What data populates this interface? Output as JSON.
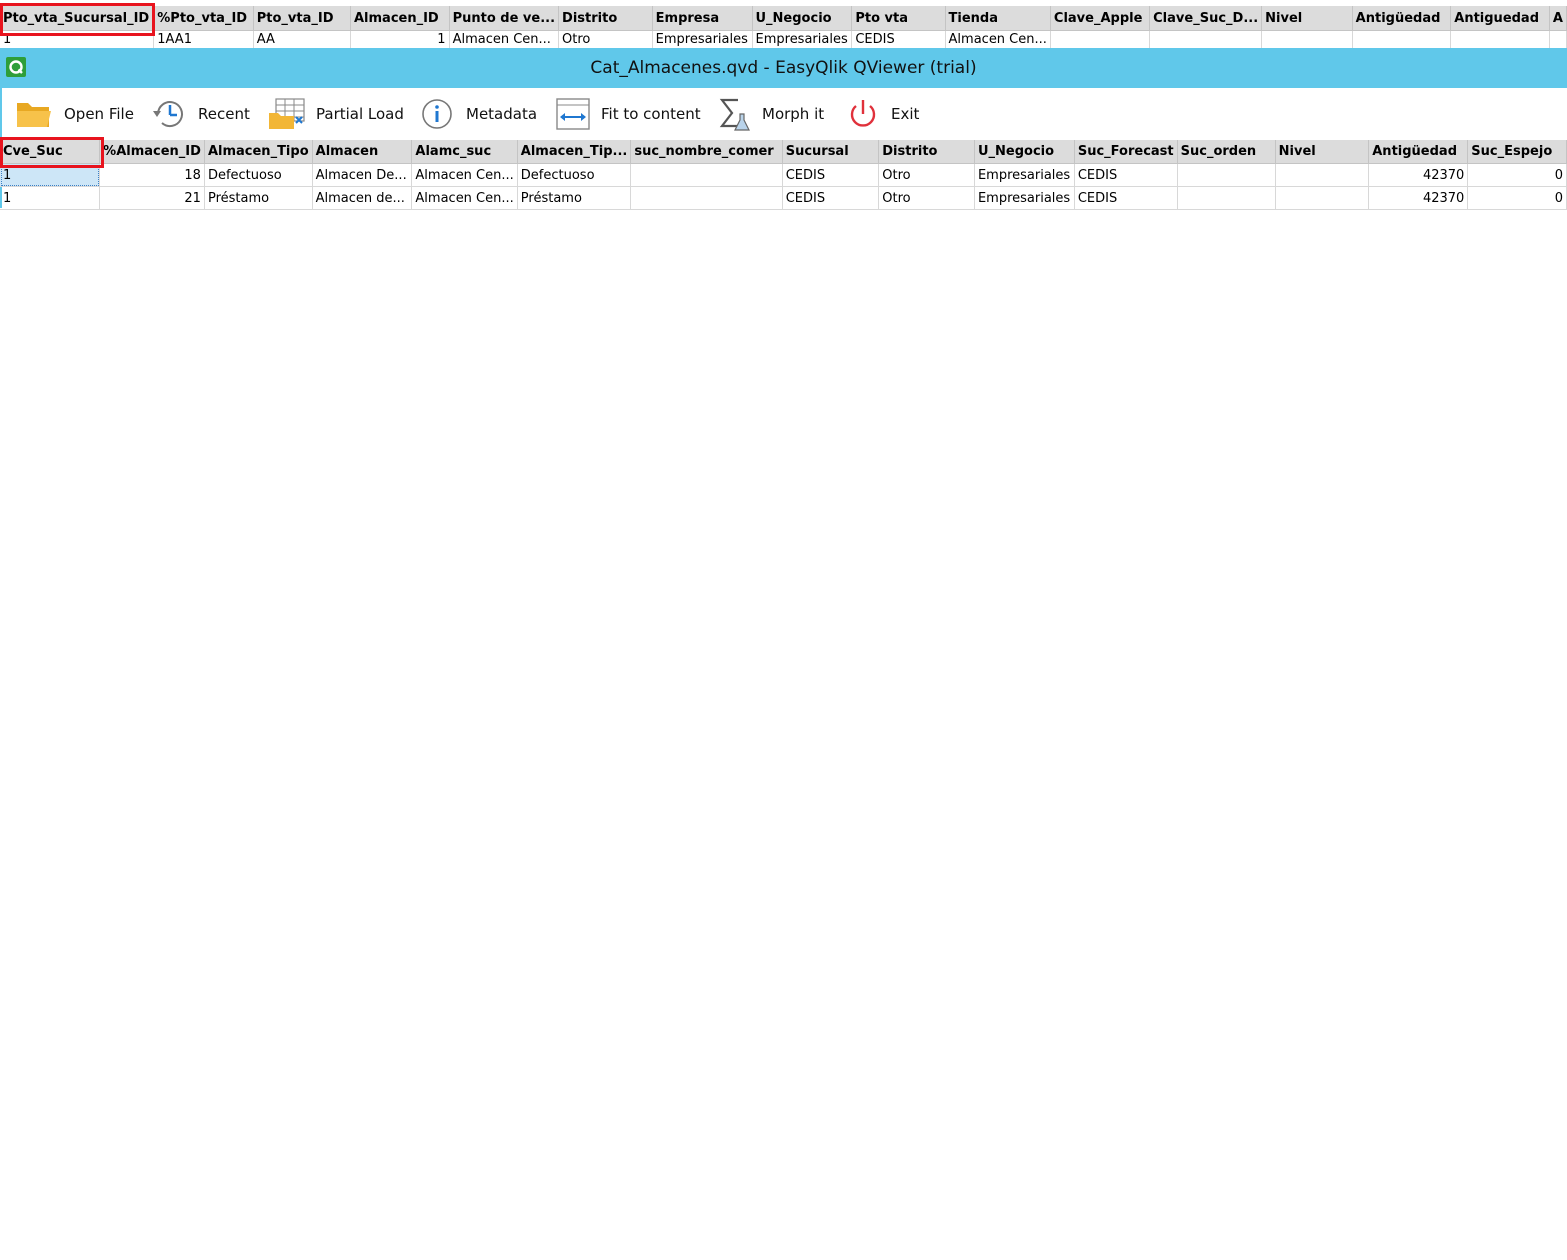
{
  "back_grid": {
    "headers": [
      "Pto_vta_Sucursal_ID",
      "%Pto_vta_ID",
      "Pto_vta_ID",
      "Almacen_ID",
      "Punto de ve...",
      "Distrito",
      "Empresa",
      "U_Negocio",
      "Pto vta",
      "Tienda",
      "Clave_Apple",
      "Clave_Suc_D...",
      "Nivel",
      "Antigüedad",
      "Antiguedad",
      "A"
    ],
    "rows": [
      [
        "1",
        "1AA1",
        "AA",
        "1",
        "Almacen Cen...",
        "Otro",
        "Empresariales",
        "Empresariales",
        "CEDIS",
        "Almacen Cen...",
        "",
        "",
        "",
        "",
        "",
        ""
      ]
    ]
  },
  "window": {
    "title": "Cat_Almacenes.qvd - EasyQlik QViewer (trial)"
  },
  "toolbar": {
    "open_file": "Open File",
    "recent": "Recent",
    "partial_load": "Partial Load",
    "metadata": "Metadata",
    "fit_to_content": "Fit to content",
    "morph_it": "Morph it",
    "exit": "Exit"
  },
  "grid": {
    "headers": [
      "Cve_Suc",
      "%Almacen_ID",
      "Almacen_Tipo",
      "Almacen",
      "Alamc_suc",
      "Almacen_Tip...",
      "suc_nombre_comer",
      "Sucursal",
      "Distrito",
      "U_Negocio",
      "Suc_Forecast",
      "Suc_orden",
      "Nivel",
      "Antigüedad",
      "Suc_Espejo"
    ],
    "rows": [
      [
        "1",
        "18",
        "Defectuoso",
        "Almacen De...",
        "Almacen Cen...",
        "Defectuoso",
        "",
        "CEDIS",
        "Otro",
        "Empresariales",
        "CEDIS",
        "",
        "",
        "42370",
        "0"
      ],
      [
        "1",
        "21",
        "Préstamo",
        "Almacen de...",
        "Almacen Cen...",
        "Préstamo",
        "",
        "CEDIS",
        "Otro",
        "Empresariales",
        "CEDIS",
        "",
        "",
        "42370",
        "0"
      ]
    ]
  },
  "colors": {
    "titlebar": "#60c8ea",
    "highlight": "#e8141e",
    "header_bg": "#dcdcdc"
  }
}
